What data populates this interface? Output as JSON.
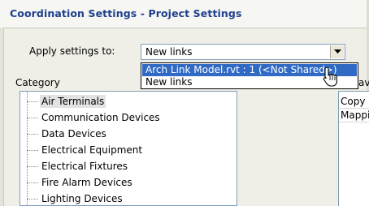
{
  "window": {
    "title": "Coordination Settings - Project Settings"
  },
  "apply": {
    "label": "Apply settings to:",
    "selected_value": "New links",
    "options": [
      "Arch Link Model.rvt : 1 (<Not Shared>)",
      "New links"
    ],
    "highlighted_index": 0
  },
  "category": {
    "header": "Category",
    "items": [
      "Air Terminals",
      "Communication Devices",
      "Data Devices",
      "Electrical Equipment",
      "Electrical Fixtures",
      "Fire Alarm Devices",
      "Lighting Devices"
    ],
    "selected_index": 0
  },
  "behavior": {
    "header_fragment": "avi",
    "rows": [
      "Copy",
      "Mappi"
    ]
  },
  "colors": {
    "title": "#1f3f8f",
    "selection": "#316ac5",
    "window_bg": "#f0efe7"
  },
  "icons": {
    "dropdown": "chevron-down-icon",
    "cursor": "pointer-cursor-icon"
  }
}
